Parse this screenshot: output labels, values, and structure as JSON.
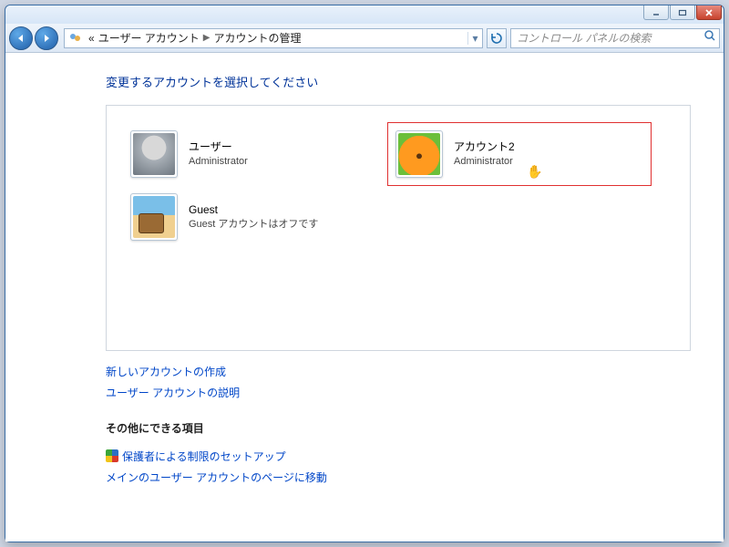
{
  "breadcrumb": {
    "prefix": "«",
    "seg1": "ユーザー アカウント",
    "seg2": "アカウントの管理"
  },
  "search": {
    "placeholder": "コントロール パネルの検索"
  },
  "heading": "変更するアカウントを選択してください",
  "accounts": [
    {
      "name": "ユーザー",
      "role": "Administrator",
      "icon": "user",
      "highlight": false
    },
    {
      "name": "アカウント2",
      "role": "Administrator",
      "icon": "flower",
      "highlight": true
    },
    {
      "name": "Guest",
      "role": "Guest アカウントはオフです",
      "icon": "guest",
      "highlight": false
    }
  ],
  "links": {
    "create": "新しいアカウントの作成",
    "about": "ユーザー アカウントの説明"
  },
  "other": {
    "title": "その他にできる項目",
    "parental": "保護者による制限のセットアップ",
    "main_page": "メインのユーザー アカウントのページに移動"
  }
}
